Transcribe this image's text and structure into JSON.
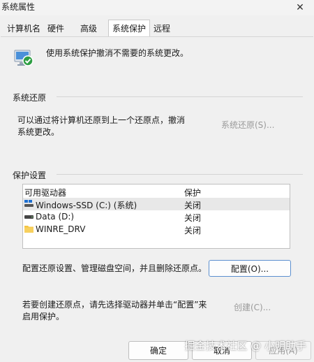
{
  "window": {
    "title": "系统属性",
    "close_glyph": "✕"
  },
  "tabs": [
    {
      "label": "计算机名"
    },
    {
      "label": "硬件"
    },
    {
      "label": "高级"
    },
    {
      "label": "系统保护",
      "active": true
    },
    {
      "label": "远程"
    }
  ],
  "header": {
    "description": "使用系统保护撤消不需要的系统更改。",
    "icon": "system-protection-icon"
  },
  "restore_section": {
    "title": "系统还原",
    "description_line1": "可以通过将计算机还原到上一个还原点，撤消",
    "description_line2": "系统更改。",
    "button_label": "系统还原(S)..."
  },
  "protection_section": {
    "title": "保护设置",
    "columns": [
      "可用驱动器",
      "保护"
    ],
    "drives": [
      {
        "name": "Windows-SSD (C:) (系统)",
        "protection": "关闭",
        "icon": "system-drive-icon"
      },
      {
        "name": "Data (D:)",
        "protection": "关闭",
        "icon": "drive-icon"
      },
      {
        "name": "WINRE_DRV",
        "protection": "关闭",
        "icon": "folder-icon"
      }
    ],
    "configure_text": "配置还原设置、管理磁盘空间，并且删除还原点。",
    "configure_button": "配置(O)...",
    "create_text_line1": "若要创建还原点，请先选择驱动器并单击“配置”来",
    "create_text_line2": "启用保护。",
    "create_button": "创建(C)..."
  },
  "footer": {
    "ok": "确定",
    "cancel": "取消",
    "apply": "应用(A)"
  },
  "watermark": "掘金技术社区 @ 小明助手",
  "colors": {
    "accent": "#0067c0",
    "window_bg": "#f0f0f0",
    "disabled_text": "#9a9a9a"
  }
}
